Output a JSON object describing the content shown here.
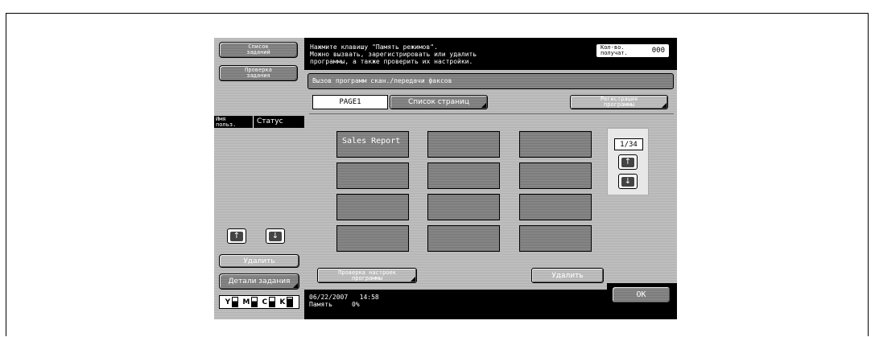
{
  "left_panel": {
    "job_list_label": "Список\nзаданий",
    "job_check_label": "Проверка\nзадания",
    "user_label": "Имя\nпольз.",
    "status_label": "Статус",
    "delete_label": "Удалить",
    "job_details_label": "Детали задания",
    "arrow_up": "↑",
    "arrow_down": "↓"
  },
  "toner": {
    "colors": [
      "Y",
      "M",
      "C",
      "K"
    ],
    "levels": [
      0.5,
      0.5,
      0.5,
      0.8
    ]
  },
  "message": "Нажмите клавишу \"Память режимов\".\nМожно вызвать, зарегистрировать или удалить\nпрограммы, а также проверить их настройки.",
  "copies": {
    "label": "Кол-во.\nполучат.",
    "value": "000"
  },
  "panel_title": "Вызов программ скан./передачи факсов",
  "tabs": [
    {
      "label": "PAGE1",
      "active": true
    },
    {
      "label": "Список страниц",
      "active": false
    }
  ],
  "register_program_label": "Регистрация\nпрограммы",
  "programs": [
    "Sales Report",
    "",
    "",
    "",
    "",
    "",
    "",
    "",
    "",
    "",
    "",
    ""
  ],
  "pager": {
    "page": "1/34",
    "up": "↑",
    "down": "↓"
  },
  "check_settings_label": "Проверка настроек\nпрограммы",
  "delete_program_label": "Удалить",
  "ok_label": "OK",
  "status_bar": {
    "date": "06/22/2007",
    "time": "14:58",
    "memory_label": "Память",
    "memory_value": "0%"
  }
}
